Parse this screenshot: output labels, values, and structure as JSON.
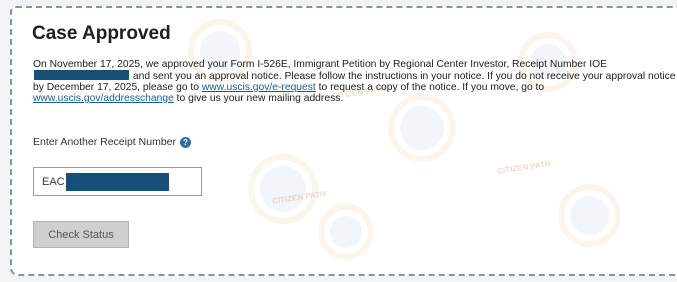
{
  "case_status": {
    "title": "Case Approved",
    "notice": {
      "text_before_receipt": "On November 17, 2025, we approved your Form I-526E, Immigrant Petition by Regional Center Investor, Receipt Number IOE",
      "text_after_receipt": " and sent you an approval notice. Please follow the instructions in your notice. If you do not receive your approval notice by December 17, 2025, please go to ",
      "link_request": "www.uscis.gov/e-request",
      "text_after_link": " to request a copy of the notice. If you move, go to ",
      "link_address": "www.uscis.gov/addresschange",
      "text_end": " to give us your new mailing address."
    }
  },
  "receipt_lookup": {
    "label": "Enter Another Receipt Number",
    "help_icon": "?",
    "input_value_prefix": "EAC",
    "button_label": "Check Status"
  },
  "watermark": {
    "text": "CITIZEN PATH"
  },
  "colors": {
    "redaction": "#174f78",
    "link": "#145e94",
    "dashed_border": "#7d96b2",
    "button_bg": "#cfcfcf"
  }
}
